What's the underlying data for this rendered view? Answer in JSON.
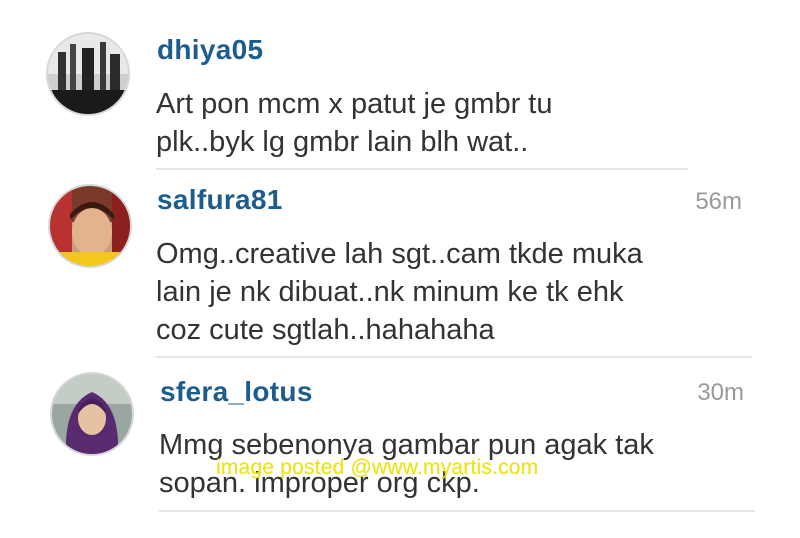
{
  "comments": [
    {
      "username": "dhiya05",
      "time": "",
      "lines": [
        "Art pon mcm x patut je gmbr tu",
        "plk..byk lg gmbr lain blh wat.."
      ]
    },
    {
      "username": "salfura81",
      "time": "56m",
      "lines": [
        "Omg..creative lah sgt..cam tkde  muka",
        "lain je nk dibuat..nk minum ke tk ehk",
        "coz cute sgtlah..hahahaha"
      ]
    },
    {
      "username": "sfera_lotus",
      "time": "30m",
      "lines": [
        "Mmg sebenonya gambar pun agak tak",
        "sopan. improper org ckp."
      ]
    }
  ],
  "watermark": "image posted @www.myartis.com",
  "colors": {
    "username": "#1d5d8d",
    "time": "#9a9a9a",
    "text": "#333333",
    "watermark": "#f2e600"
  }
}
